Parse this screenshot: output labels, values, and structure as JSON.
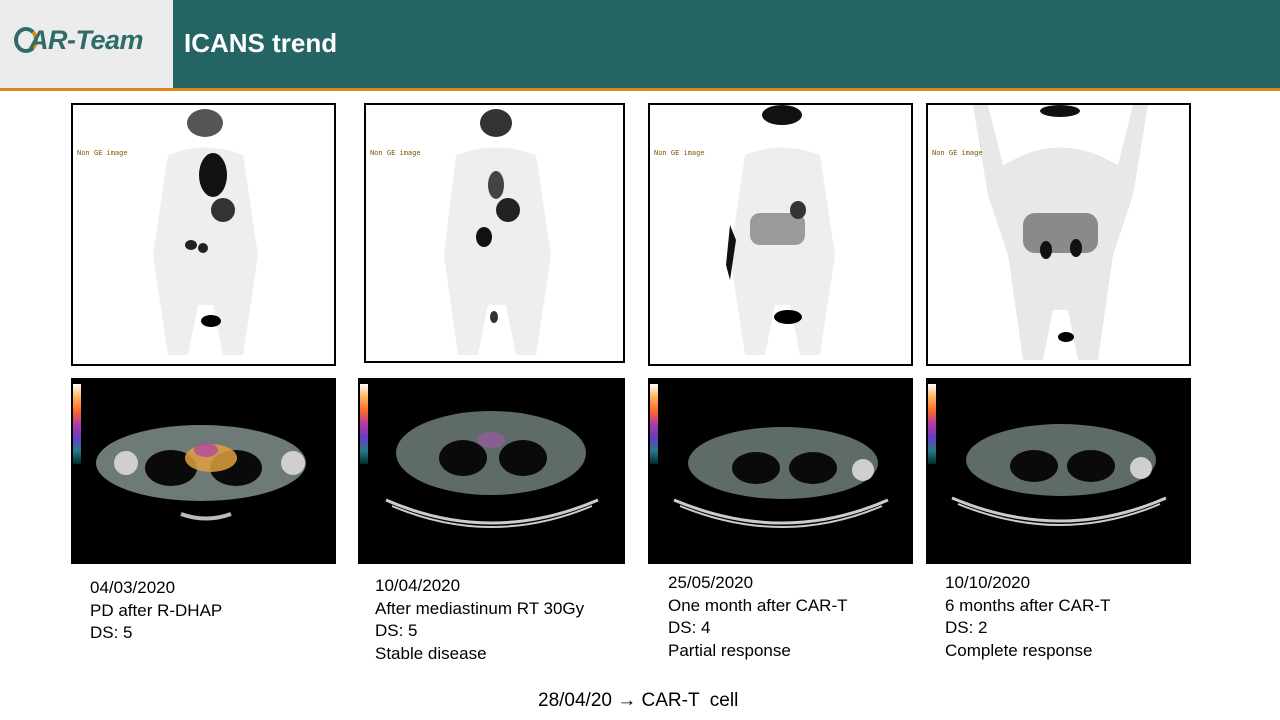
{
  "header": {
    "logo_text": "AR-Team",
    "title": "ICANS trend"
  },
  "pet_scans": [
    {
      "tag": "Non GE image"
    },
    {
      "tag": "Non GE image"
    },
    {
      "tag": "Non GE image"
    },
    {
      "tag": "Non GE image"
    }
  ],
  "timepoints": [
    {
      "date": "04/03/2020",
      "line1": "PD after R-DHAP",
      "line2": "DS: 5",
      "line3": ""
    },
    {
      "date": "10/04/2020",
      "line1": "After mediastinum RT 30Gy",
      "line2": "DS: 5",
      "line3": "Stable disease"
    },
    {
      "date": "25/05/2020",
      "line1": "One month after CAR-T",
      "line2": "DS: 4",
      "line3": "Partial response"
    },
    {
      "date": "10/10/2020",
      "line1": "6 months after CAR-T",
      "line2": "DS: 2",
      "line3": "Complete response"
    }
  ],
  "footer": {
    "date": "28/04/20",
    "arrow": "→",
    "label": "CAR-T  cell"
  }
}
